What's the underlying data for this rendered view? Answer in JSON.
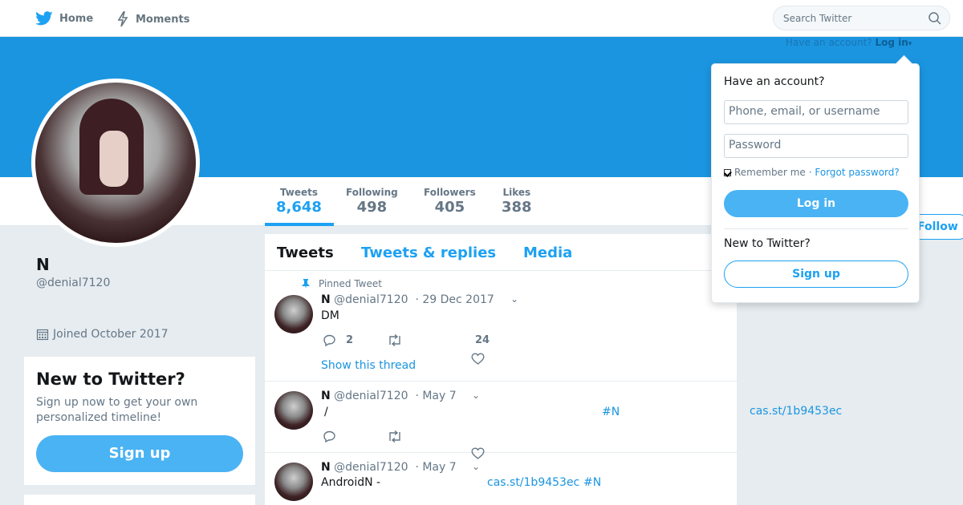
{
  "nav": {
    "home_label": "Home",
    "moments_label": "Moments",
    "search_placeholder": "Search Twitter"
  },
  "login_prompt": {
    "text": "Have an account?",
    "link": "Log in"
  },
  "profile": {
    "name": "N",
    "handle": "@denial7120",
    "joined": "Joined October 2017"
  },
  "stats": [
    {
      "label": "Tweets",
      "value": "8,648"
    },
    {
      "label": "Following",
      "value": "498"
    },
    {
      "label": "Followers",
      "value": "405"
    },
    {
      "label": "Likes",
      "value": "388"
    }
  ],
  "follow_label": "Follow",
  "signup_card": {
    "title": "New to Twitter?",
    "text": "Sign up now to get your own personalized timeline!",
    "button": "Sign up"
  },
  "tabs": [
    "Tweets",
    "Tweets & replies",
    "Media"
  ],
  "tweets": [
    {
      "pinned_label": "Pinned Tweet",
      "name": "N",
      "handle": "@denial7120",
      "date": "· 29 Dec 2017",
      "text": "DM",
      "reply_count": "2",
      "like_count": "24",
      "thread_label": "Show this thread"
    },
    {
      "name": "N",
      "handle": "@denial7120",
      "date": "· May 7",
      "text": "/",
      "hashtag": "#N"
    },
    {
      "name": "N",
      "handle": "@denial7120",
      "date": "· May 7",
      "text": "AndroidN -",
      "link": "cas.st/1b9453ec",
      "hashtag": "#N"
    }
  ],
  "side_link": "cas.st/1b9453ec",
  "login_dropdown": {
    "title": "Have an account?",
    "username_placeholder": "Phone, email, or username",
    "password_placeholder": "Password",
    "remember_label": "Remember me",
    "forgot_label": "· Forgot password?",
    "login_button": "Log in",
    "new_label": "New to Twitter?",
    "signup_button": "Sign up"
  },
  "colors": {
    "brand_blue": "#1da1f2",
    "banner_blue": "#1b95e0",
    "button_blue": "#4ab3f4"
  }
}
